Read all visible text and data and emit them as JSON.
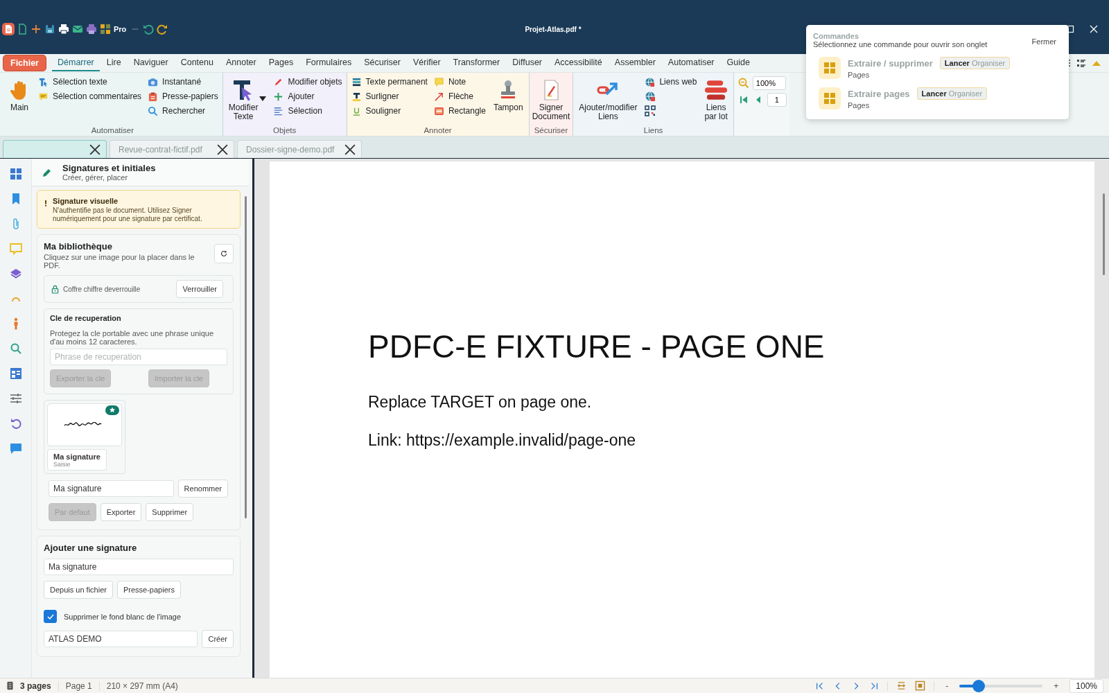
{
  "app": {
    "pro_label": "Pro",
    "title": "Projet-Atlas.pdf *"
  },
  "menu_tabs": [
    {
      "label": "Fichier",
      "kind": "file",
      "selected": false
    },
    {
      "label": "Démarrer",
      "kind": "tab",
      "selected": true
    },
    {
      "label": "Lire",
      "kind": "tab",
      "selected": false
    },
    {
      "label": "Naviguer",
      "kind": "tab",
      "selected": false
    },
    {
      "label": "Contenu",
      "kind": "tab",
      "selected": false
    },
    {
      "label": "Annoter",
      "kind": "tab",
      "selected": false
    },
    {
      "label": "Pages",
      "kind": "tab",
      "selected": false
    },
    {
      "label": "Formulaires",
      "kind": "tab",
      "selected": false
    },
    {
      "label": "Sécuriser",
      "kind": "tab",
      "selected": false
    },
    {
      "label": "Vérifier",
      "kind": "tab",
      "selected": false
    },
    {
      "label": "Transformer",
      "kind": "tab",
      "selected": false
    },
    {
      "label": "Diffuser",
      "kind": "tab",
      "selected": false
    },
    {
      "label": "Accessibilité",
      "kind": "tab",
      "selected": false
    },
    {
      "label": "Assembler",
      "kind": "tab",
      "selected": false
    },
    {
      "label": "Automatiser",
      "kind": "tab",
      "selected": false
    },
    {
      "label": "Guide",
      "kind": "tab",
      "selected": false
    }
  ],
  "ribbon": {
    "groups": [
      {
        "kind": "automate",
        "label": "Automatiser",
        "columns": [
          [
            {
              "kind": "large",
              "label": "Main"
            }
          ],
          [
            {
              "kind": "small",
              "label": "Sélection texte"
            },
            {
              "kind": "small",
              "label": "Sélection commentaires"
            }
          ],
          [
            {
              "kind": "small",
              "label": "Instantané"
            },
            {
              "kind": "small",
              "label": "Presse-papiers"
            },
            {
              "kind": "small",
              "label": "Rechercher"
            }
          ]
        ]
      },
      {
        "kind": "objects",
        "label": "Objets",
        "columns": [
          [
            {
              "kind": "large",
              "label": "Modifier\nTexte"
            }
          ],
          [
            {
              "kind": "caret"
            }
          ],
          [
            {
              "kind": "small",
              "label": "Modifier objets"
            },
            {
              "kind": "small",
              "label": "Ajouter"
            },
            {
              "kind": "small",
              "label": "Sélection"
            }
          ]
        ]
      },
      {
        "kind": "annotate",
        "label": "Annoter",
        "columns": [
          [
            {
              "kind": "small",
              "label": "Texte permanent"
            },
            {
              "kind": "small",
              "label": "Surligner"
            },
            {
              "kind": "small",
              "label": "Souligner"
            }
          ],
          [
            {
              "kind": "small",
              "label": "Note"
            },
            {
              "kind": "small",
              "label": "Flèche"
            },
            {
              "kind": "small",
              "label": "Rectangle"
            }
          ],
          [
            {
              "kind": "large",
              "label": "Tampon"
            }
          ]
        ]
      },
      {
        "kind": "secure",
        "label": "Sécuriser",
        "columns": [
          [
            {
              "kind": "large",
              "label": "Signer\nDocument"
            }
          ]
        ]
      },
      {
        "kind": "links",
        "label": "Liens",
        "columns": [
          [
            {
              "kind": "large",
              "label": "Ajouter/modifier\nLiens"
            }
          ],
          [
            {
              "kind": "small",
              "label": "Liens web"
            },
            {
              "kind": "icon"
            },
            {
              "kind": "icon"
            }
          ],
          [
            {
              "kind": "large",
              "label": "Liens\npar lot"
            }
          ]
        ]
      },
      {
        "kind": "zoom",
        "rows": [
          [
            {
              "kind": "icon"
            },
            {
              "kind": "field",
              "value": "100%"
            }
          ],
          [
            {
              "kind": "icon"
            },
            {
              "kind": "icon"
            },
            {
              "kind": "field",
              "value": "1"
            }
          ]
        ]
      }
    ]
  },
  "doc_tabs": [
    {
      "selected": true
    },
    {
      "label": "Revue-contrat-fictif.pdf",
      "selected": false
    },
    {
      "label": "Dossier-signe-demo.pdf",
      "selected": false
    }
  ],
  "commands_popover": {
    "title": "Commandes",
    "subtitle": "Sélectionnez une commande pour ouvrir son onglet",
    "close": "Fermer",
    "commands": [
      {
        "name": "Extraire / supprimer",
        "category": "Pages",
        "action": "Lancer",
        "tab": "Organiser"
      },
      {
        "name": "Extraire pages",
        "category": "Pages",
        "action": "Lancer",
        "tab": "Organiser"
      }
    ]
  },
  "panel": {
    "title": "Signatures et initiales",
    "subtitle": "Créer, gérer, placer",
    "warning": {
      "title": "Signature visuelle",
      "text": "N'authentifie pas le document. Utilisez Signer numériquement pour une signature par certificat."
    },
    "library": {
      "title": "Ma bibliothèque",
      "hint": "Cliquez sur une image pour la placer dans le PDF.",
      "vault": {
        "text": "Coffre chiffre deverrouille",
        "button": "Verrouiller"
      },
      "recovery": {
        "title": "Cle de recuperation",
        "text": "Protegez la cle portable avec une phrase unique d'au moins 12 caracteres.",
        "placeholder": "Phrase de recuperation",
        "buttons": [
          {
            "label": "Exporter la cle",
            "disabled": true
          },
          {
            "label": "Importer la cle",
            "disabled": true
          }
        ]
      },
      "signature": {
        "name": "Ma signature",
        "source": "Saisie",
        "favorite": true
      },
      "name_field": {
        "value": "Ma signature"
      },
      "rename": "Renommer",
      "actions": [
        {
          "label": "Par defaut",
          "disabled": true
        },
        {
          "label": "Exporter",
          "disabled": false
        },
        {
          "label": "Supprimer",
          "disabled": false
        }
      ]
    },
    "add": {
      "title": "Ajouter une signature",
      "name_field": {
        "value": "Ma signature"
      },
      "buttons": [
        "Depuis un fichier",
        "Presse-papiers"
      ],
      "remove_background": {
        "label": "Supprimer le fond blanc de l'image",
        "checked": true
      },
      "text_field": {
        "value": "ATLAS DEMO"
      },
      "create": "Créer"
    }
  },
  "document": {
    "heading": "PDFC-E FIXTURE - PAGE ONE",
    "lines": [
      "Replace TARGET on page one.",
      "Link: https://example.invalid/page-one"
    ]
  },
  "status_bar": {
    "pages": "3 pages",
    "page": "Page 1",
    "size": "210 × 297 mm (A4)",
    "zoom_out": "-",
    "zoom_in": "+",
    "zoom": {
      "level": 0.18
    },
    "zoom_value": "100%"
  }
}
